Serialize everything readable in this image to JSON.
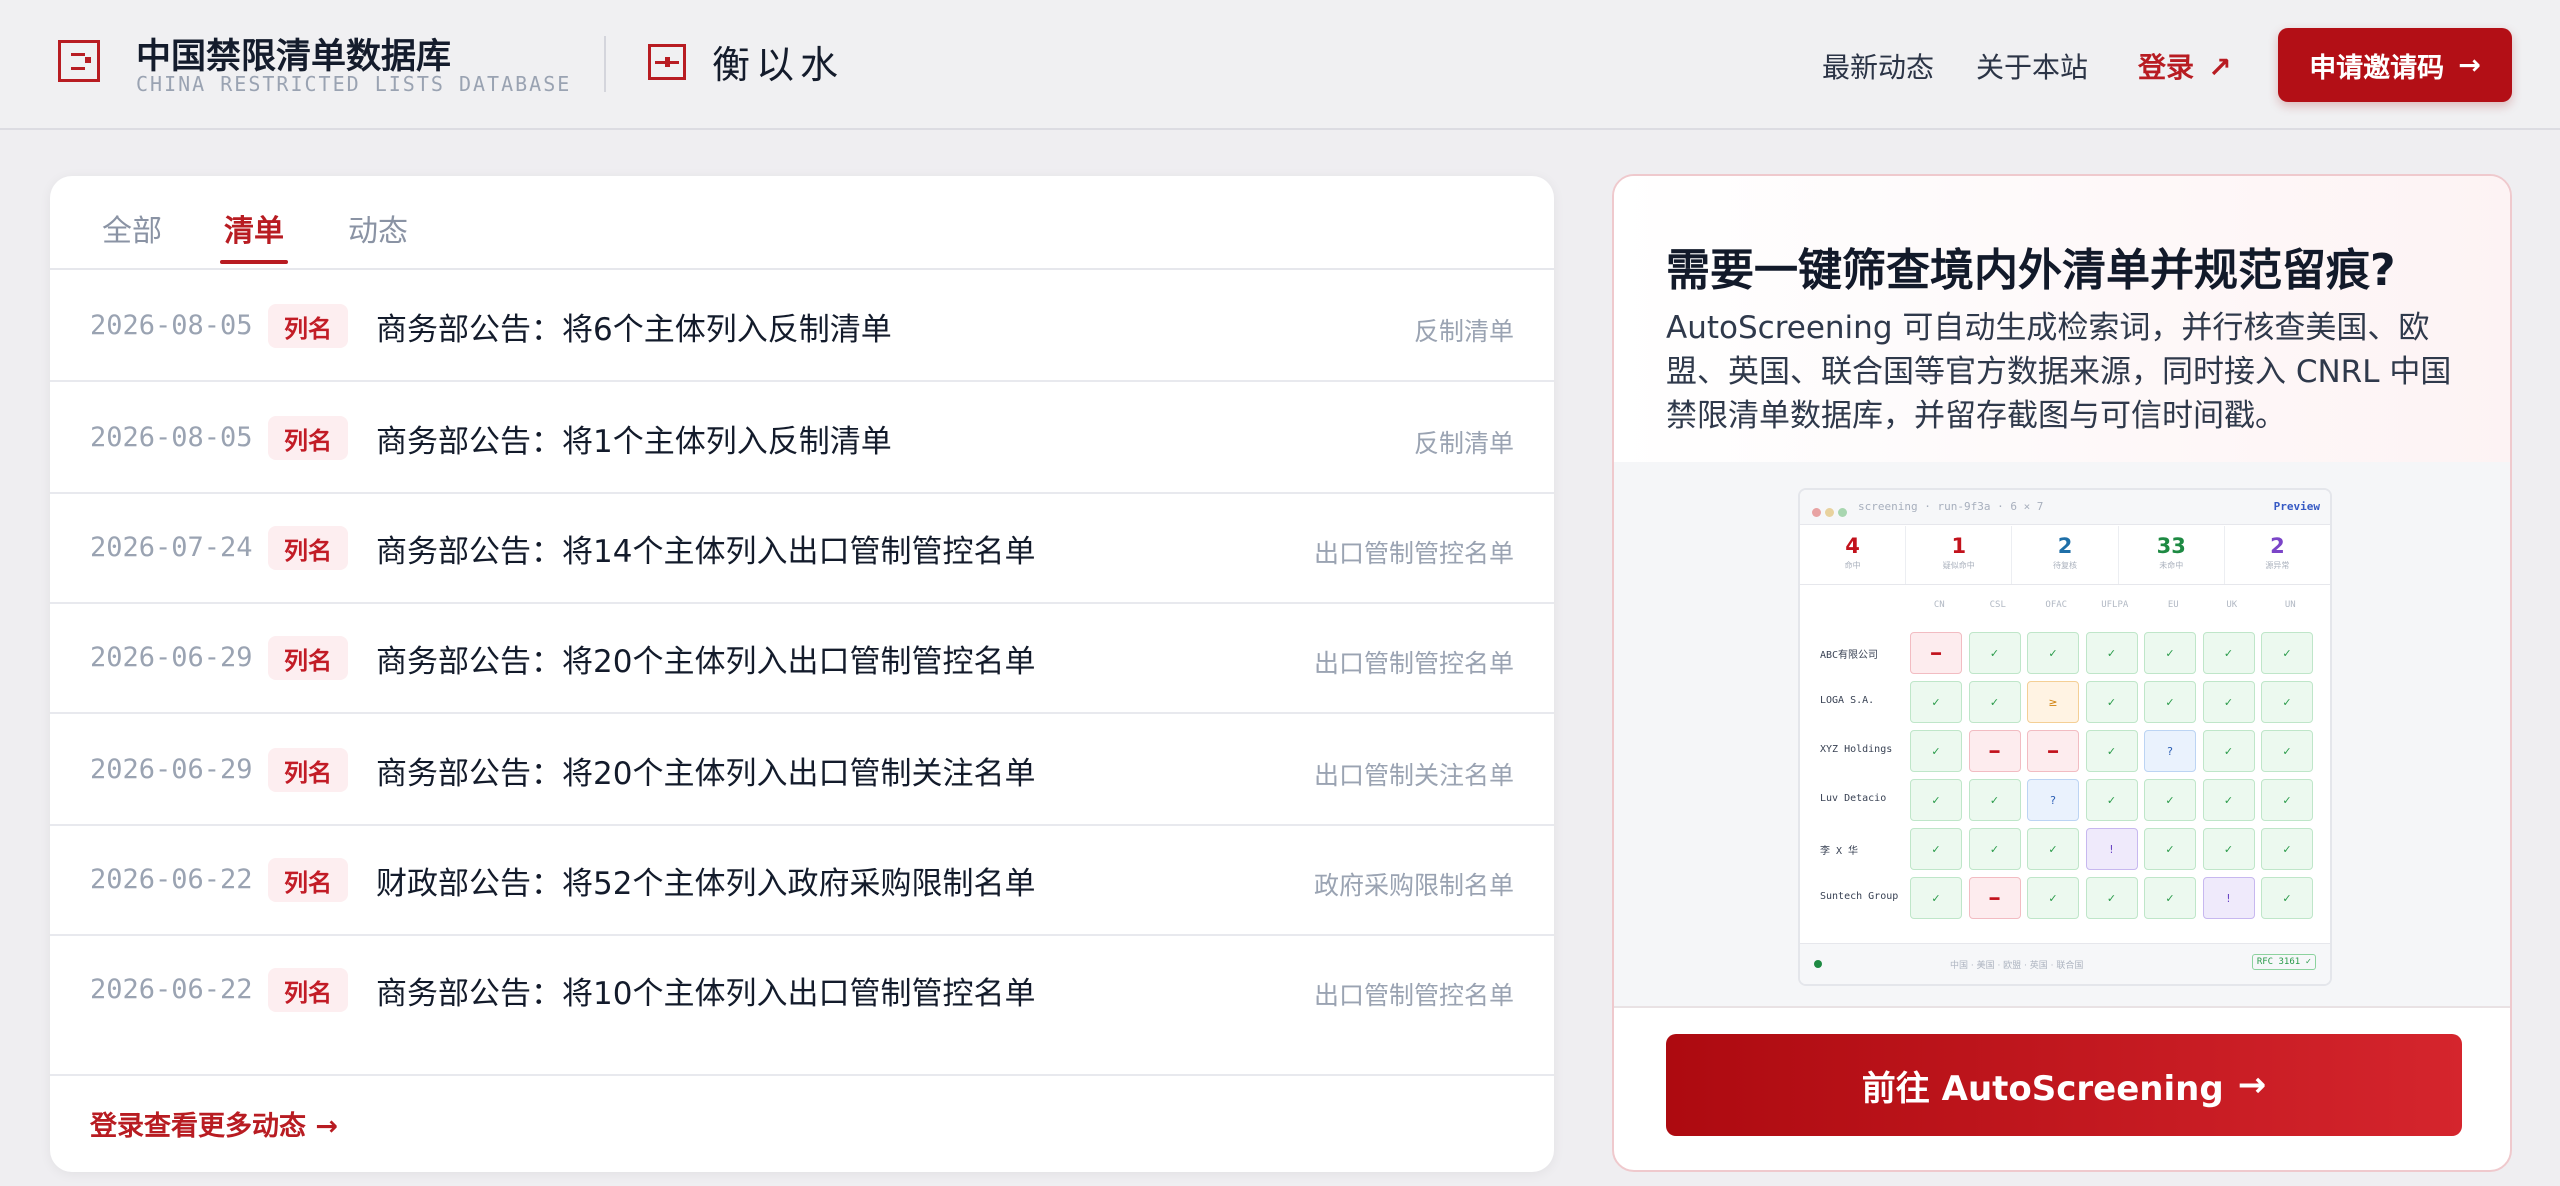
{
  "header": {
    "brand_title": "中国禁限清单数据库",
    "brand_subtitle": "CHINA RESTRICTED LISTS DATABASE",
    "brand2": "衡以水",
    "nav": {
      "news": "最新动态",
      "about": "关于本站",
      "login": "登录",
      "login_arrow": "↗",
      "invite": "申请邀请码",
      "invite_arrow": "→"
    }
  },
  "tabs": [
    {
      "label": "全部",
      "active": false
    },
    {
      "label": "清单",
      "active": true
    },
    {
      "label": "动态",
      "active": false
    }
  ],
  "rows": [
    {
      "date": "2026-08-05",
      "badge": "列名",
      "title": "商务部公告：将6个主体列入反制清单",
      "category": "反制清单"
    },
    {
      "date": "2026-08-05",
      "badge": "列名",
      "title": "商务部公告：将1个主体列入反制清单",
      "category": "反制清单"
    },
    {
      "date": "2026-07-24",
      "badge": "列名",
      "title": "商务部公告：将14个主体列入出口管制管控名单",
      "category": "出口管制管控名单"
    },
    {
      "date": "2026-06-29",
      "badge": "列名",
      "title": "商务部公告：将20个主体列入出口管制管控名单",
      "category": "出口管制管控名单"
    },
    {
      "date": "2026-06-29",
      "badge": "列名",
      "title": "商务部公告：将20个主体列入出口管制关注名单",
      "category": "出口管制关注名单"
    },
    {
      "date": "2026-06-22",
      "badge": "列名",
      "title": "财政部公告：将52个主体列入政府采购限制名单",
      "category": "政府采购限制名单"
    },
    {
      "date": "2026-06-22",
      "badge": "列名",
      "title": "商务部公告：将10个主体列入出口管制管控名单",
      "category": "出口管制管控名单"
    }
  ],
  "more_link": "登录查看更多动态 →",
  "promo": {
    "title": "需要一键筛查境内外清单并规范留痕?",
    "description": "AutoScreening 可自动生成检索词，并行核查美国、欧盟、英国、联合国等官方数据来源，同时接入 CNRL 中国禁限清单数据库，并留存截图与可信时间戳。",
    "button": "前往 AutoScreening",
    "button_arrow": "→",
    "preview": {
      "path": "screening · run-9f3a · 6 × 7",
      "badge": "Preview",
      "stats": [
        {
          "value": "4",
          "label": "命中",
          "color": "#c2121c"
        },
        {
          "value": "1",
          "label": "疑似命中",
          "color": "#c2121c"
        },
        {
          "value": "2",
          "label": "待复核",
          "color": "#1f6fa8"
        },
        {
          "value": "33",
          "label": "未命中",
          "color": "#1e8a43"
        },
        {
          "value": "2",
          "label": "源异常",
          "color": "#7b45c8"
        }
      ],
      "columns": [
        "CN",
        "CSL",
        "OFAC",
        "UFLPA",
        "EU",
        "UK",
        "UN"
      ],
      "entities": [
        {
          "name": "ABC有限公司",
          "cells": [
            "hit",
            "ok",
            "ok",
            "ok",
            "ok",
            "ok",
            "ok"
          ]
        },
        {
          "name": "LOGA S.A.",
          "cells": [
            "ok",
            "ok",
            "x",
            "ok",
            "ok",
            "ok",
            "ok"
          ]
        },
        {
          "name": "XYZ Holdings",
          "cells": [
            "ok",
            "hit",
            "hit",
            "ok",
            "q",
            "ok",
            "ok"
          ]
        },
        {
          "name": "Luv Detacio",
          "cells": [
            "ok",
            "ok",
            "q",
            "ok",
            "ok",
            "ok",
            "ok"
          ]
        },
        {
          "name": "李 X 华",
          "cells": [
            "ok",
            "ok",
            "ok",
            "i",
            "ok",
            "ok",
            "ok"
          ]
        },
        {
          "name": "Suntech Group",
          "cells": [
            "ok",
            "hit",
            "ok",
            "ok",
            "ok",
            "i",
            "ok"
          ]
        }
      ],
      "footer_sources": "中国 · 美国 · 欧盟 · 英国 · 联合国",
      "footer_badge": "RFC 3161 ✓"
    }
  }
}
